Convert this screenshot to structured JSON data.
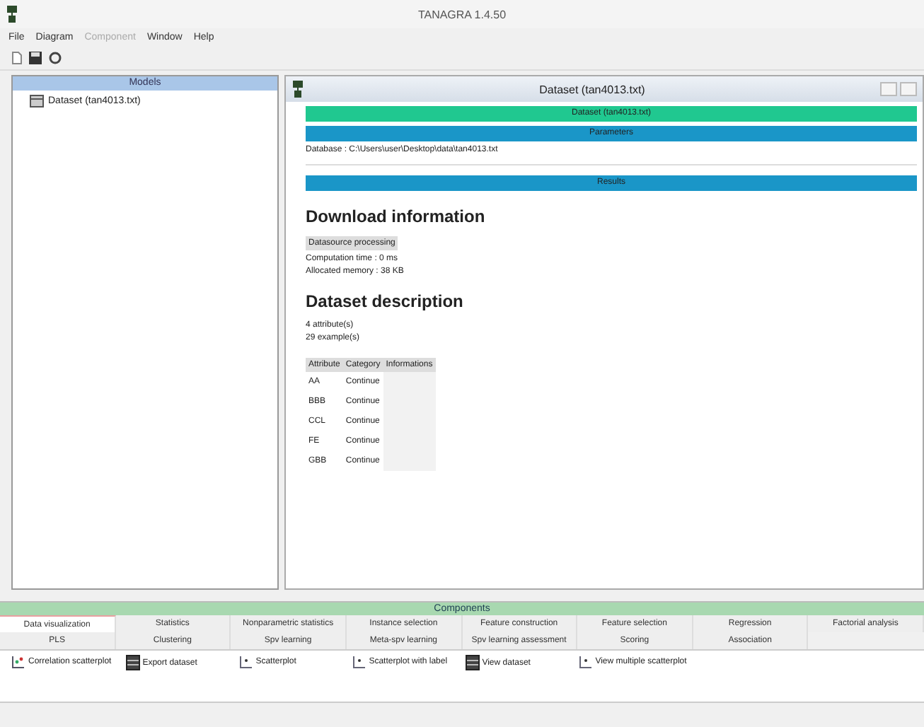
{
  "window": {
    "title": "TANAGRA 1.4.50"
  },
  "menu": [
    {
      "label": "File",
      "disabled": false
    },
    {
      "label": "Diagram",
      "disabled": false
    },
    {
      "label": "Component",
      "disabled": true
    },
    {
      "label": "Window",
      "disabled": false
    },
    {
      "label": "Help",
      "disabled": false
    }
  ],
  "stream_panel": {
    "title": "Models",
    "items": [
      {
        "label": "Dataset (tan4013.txt)"
      }
    ]
  },
  "report_window": {
    "title": "Dataset (tan4013.txt)",
    "bars": [
      {
        "kind": "title",
        "label": "Dataset (tan4013.txt)"
      },
      {
        "kind": "section",
        "label": "Parameters"
      }
    ],
    "database": "Database : C:\\Users\\user\\Desktop\\data\\tan4013.txt",
    "results_bar": "Results",
    "download_heading": "Download information",
    "download_table_header": "Datasource processing",
    "download_lines": [
      "Computation time : 0 ms",
      "Allocated memory : 38 KB"
    ],
    "description_heading": "Dataset description",
    "description_lines": [
      "4 attribute(s)",
      "29 example(s)"
    ],
    "attributes": {
      "columns": [
        "Attribute",
        "Category",
        "Informations"
      ],
      "rows": [
        [
          "AA",
          "Continue"
        ],
        [
          "BBB",
          "Continue"
        ],
        [
          "CCL",
          "Continue"
        ],
        [
          "FE",
          "Continue"
        ],
        [
          "GBB",
          "Continue"
        ]
      ]
    }
  },
  "components": {
    "title": "Components",
    "tabs": [
      [
        {
          "label": "Data visualization",
          "selected": true
        },
        {
          "label": "Statistics",
          "selected": false
        },
        {
          "label": "Nonparametric statistics",
          "selected": false
        },
        {
          "label": "Instance selection",
          "selected": false
        },
        {
          "label": "Feature construction",
          "selected": false
        },
        {
          "label": "Feature selection",
          "selected": false
        },
        {
          "label": "Regression",
          "selected": false
        },
        {
          "label": "Factorial analysis",
          "selected": false
        }
      ],
      [
        {
          "label": "PLS",
          "selected": false
        },
        {
          "label": "Clustering",
          "selected": false
        },
        {
          "label": "Spv learning",
          "selected": false
        },
        {
          "label": "Meta-spv learning",
          "selected": false
        },
        {
          "label": "Spv learning assessment",
          "selected": false
        },
        {
          "label": "Scoring",
          "selected": false
        },
        {
          "label": "Association",
          "selected": false
        }
      ]
    ],
    "items": [
      {
        "label": "Correlation scatterplot",
        "kind": "correlation"
      },
      {
        "label": "Export dataset",
        "kind": "dataset"
      },
      {
        "label": "Scatterplot",
        "kind": "scatter"
      },
      {
        "label": "Scatterplot with label",
        "kind": "scatter"
      },
      {
        "label": "View dataset",
        "kind": "dataset"
      },
      {
        "label": "View multiple scatterplot",
        "kind": "scatter"
      }
    ]
  }
}
